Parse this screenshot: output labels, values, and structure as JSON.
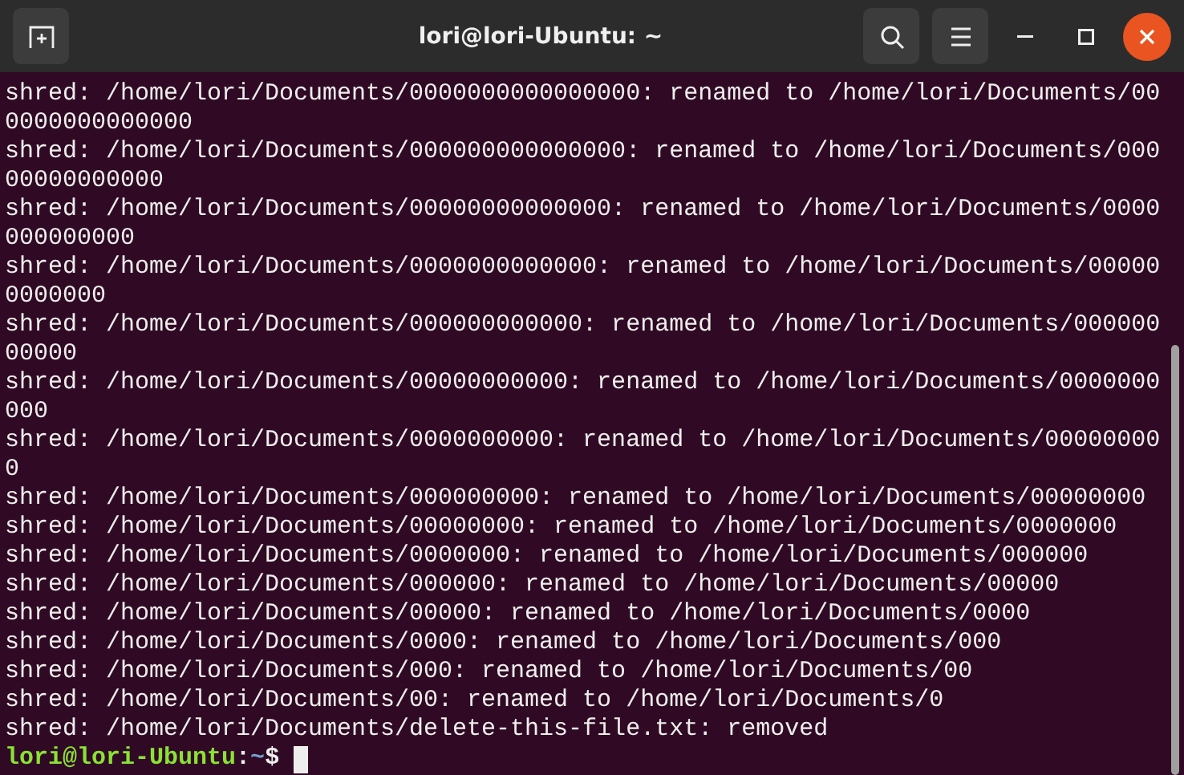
{
  "window": {
    "title": "lori@lori-Ubuntu: ~"
  },
  "output": [
    "shred: /home/lori/Documents/0000000000000000: renamed to /home/lori/Documents/000000000000000",
    "shred: /home/lori/Documents/000000000000000: renamed to /home/lori/Documents/00000000000000",
    "shred: /home/lori/Documents/00000000000000: renamed to /home/lori/Documents/0000000000000",
    "shred: /home/lori/Documents/0000000000000: renamed to /home/lori/Documents/000000000000",
    "shred: /home/lori/Documents/000000000000: renamed to /home/lori/Documents/00000000000",
    "shred: /home/lori/Documents/00000000000: renamed to /home/lori/Documents/0000000000",
    "shred: /home/lori/Documents/0000000000: renamed to /home/lori/Documents/000000000",
    "shred: /home/lori/Documents/000000000: renamed to /home/lori/Documents/00000000",
    "shred: /home/lori/Documents/00000000: renamed to /home/lori/Documents/0000000",
    "shred: /home/lori/Documents/0000000: renamed to /home/lori/Documents/000000",
    "shred: /home/lori/Documents/000000: renamed to /home/lori/Documents/00000",
    "shred: /home/lori/Documents/00000: renamed to /home/lori/Documents/0000",
    "shred: /home/lori/Documents/0000: renamed to /home/lori/Documents/000",
    "shred: /home/lori/Documents/000: renamed to /home/lori/Documents/00",
    "shred: /home/lori/Documents/00: renamed to /home/lori/Documents/0",
    "shred: /home/lori/Documents/delete-this-file.txt: removed"
  ],
  "prompt": {
    "user": "lori@lori-Ubuntu",
    "separator": ":",
    "path": "~",
    "symbol": "$"
  }
}
